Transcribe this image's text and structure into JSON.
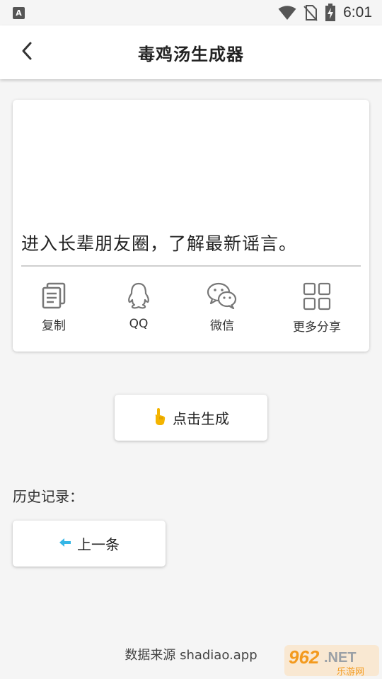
{
  "status_bar": {
    "notification_icon": "A",
    "icons": [
      "wifi-icon",
      "no-sim-icon",
      "battery-charging-icon"
    ],
    "time": "6:01"
  },
  "app_bar": {
    "back_icon": "chevron-left-icon",
    "title": "毒鸡汤生成器"
  },
  "quote": {
    "text": "进入长辈朋友圈，了解最新谣言。"
  },
  "share": {
    "items": [
      {
        "icon": "copy-icon",
        "label": "复制"
      },
      {
        "icon": "qq-icon",
        "label": "QQ"
      },
      {
        "icon": "wechat-icon",
        "label": "微信"
      },
      {
        "icon": "grid-icon",
        "label": "更多分享"
      }
    ]
  },
  "generate": {
    "icon": "pointing-hand-icon",
    "label": "点击生成"
  },
  "history": {
    "title": "历史记录：",
    "prev_icon": "arrow-left-icon",
    "prev_label": "上一条"
  },
  "footer": {
    "source": "数据来源 shadiao.app",
    "watermark_main": "962.NET",
    "watermark_sub": "乐游网"
  },
  "colors": {
    "accent_arrow": "#35b6e6",
    "hand": "#f4b400",
    "watermark_orange": "#f39a1e"
  }
}
